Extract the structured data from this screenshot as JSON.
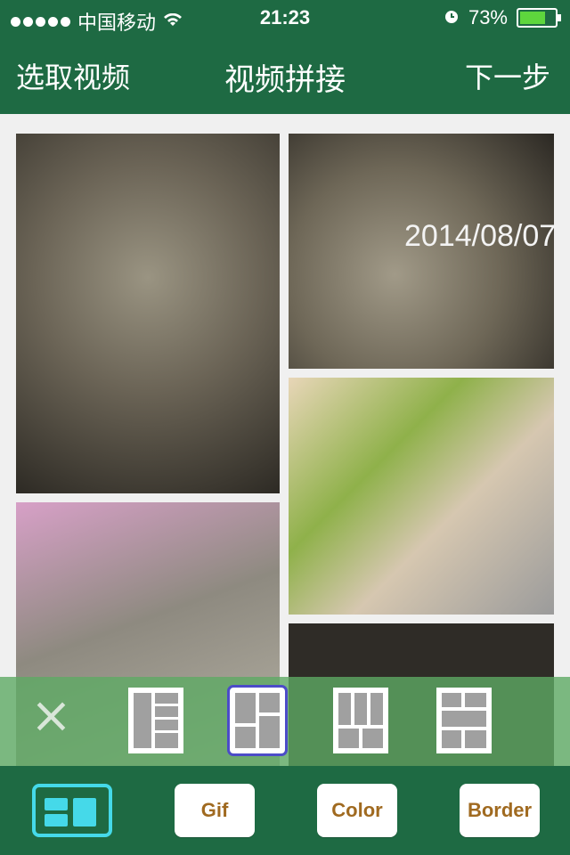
{
  "status_bar": {
    "carrier": "中国移动",
    "time": "21:23",
    "battery_percent": "73%",
    "battery_level": 0.73
  },
  "nav": {
    "left_button": "选取视频",
    "title": "视频拼接",
    "right_button": "下一步"
  },
  "grid": {
    "tiles": [
      {
        "name": "video-tile-1"
      },
      {
        "name": "video-tile-2",
        "timestamp": "2014/08/07"
      },
      {
        "name": "video-tile-3"
      },
      {
        "name": "video-tile-4"
      },
      {
        "name": "video-tile-5"
      }
    ]
  },
  "layout_toolbar": {
    "close_icon": "close-icon",
    "layouts": [
      {
        "icon": "layout-1-icon",
        "selected": false
      },
      {
        "icon": "layout-2-icon",
        "selected": true
      },
      {
        "icon": "layout-3-icon",
        "selected": false
      },
      {
        "icon": "layout-4-icon",
        "selected": false
      }
    ]
  },
  "bottom_bar": {
    "buttons": [
      {
        "label": "Gif"
      },
      {
        "label": "Color"
      },
      {
        "label": "Border"
      }
    ],
    "active_mode": "layout-mode"
  },
  "colors": {
    "bar_green": "#1e6a43",
    "toolbar_green": "#5eaa64",
    "accent_cyan": "#45d9e9",
    "selection_blue": "#4c4cc8",
    "button_text": "#a06a20"
  }
}
